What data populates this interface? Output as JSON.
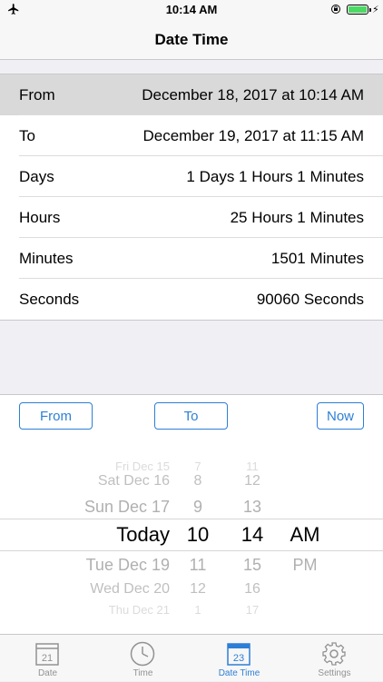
{
  "status_bar": {
    "time": "10:14 AM",
    "battery_color": "#4cd964"
  },
  "nav": {
    "title": "Date Time"
  },
  "rows": [
    {
      "label": "From",
      "value": "December 18, 2017 at 10:14 AM"
    },
    {
      "label": "To",
      "value": "December 19, 2017 at 11:15 AM"
    },
    {
      "label": "Days",
      "value": "1 Days 1 Hours 1 Minutes"
    },
    {
      "label": "Hours",
      "value": "25 Hours 1 Minutes"
    },
    {
      "label": "Minutes",
      "value": "1501 Minutes"
    },
    {
      "label": "Seconds",
      "value": "90060 Seconds"
    }
  ],
  "buttons": {
    "from": "From",
    "to": "To",
    "now": "Now"
  },
  "picker": {
    "days": [
      "Fri Dec 15",
      "Sat Dec 16",
      "Sun Dec 17",
      "Today",
      "Tue Dec 19",
      "Wed Dec 20",
      "Thu Dec 21"
    ],
    "hours": [
      "7",
      "8",
      "9",
      "10",
      "11",
      "12",
      "1"
    ],
    "minutes": [
      "11",
      "12",
      "13",
      "14",
      "15",
      "16",
      "17"
    ],
    "ampm": [
      "AM",
      "PM"
    ]
  },
  "tabs": [
    {
      "label": "Date",
      "icon": "calendar-21-icon",
      "badge": "21"
    },
    {
      "label": "Time",
      "icon": "clock-icon"
    },
    {
      "label": "Date Time",
      "icon": "calendar-23-icon",
      "badge": "23"
    },
    {
      "label": "Settings",
      "icon": "gear-icon"
    }
  ],
  "colors": {
    "accent": "#2d7fd6",
    "selected_row": "#d9d9d9",
    "inactive_tab": "#929292"
  }
}
